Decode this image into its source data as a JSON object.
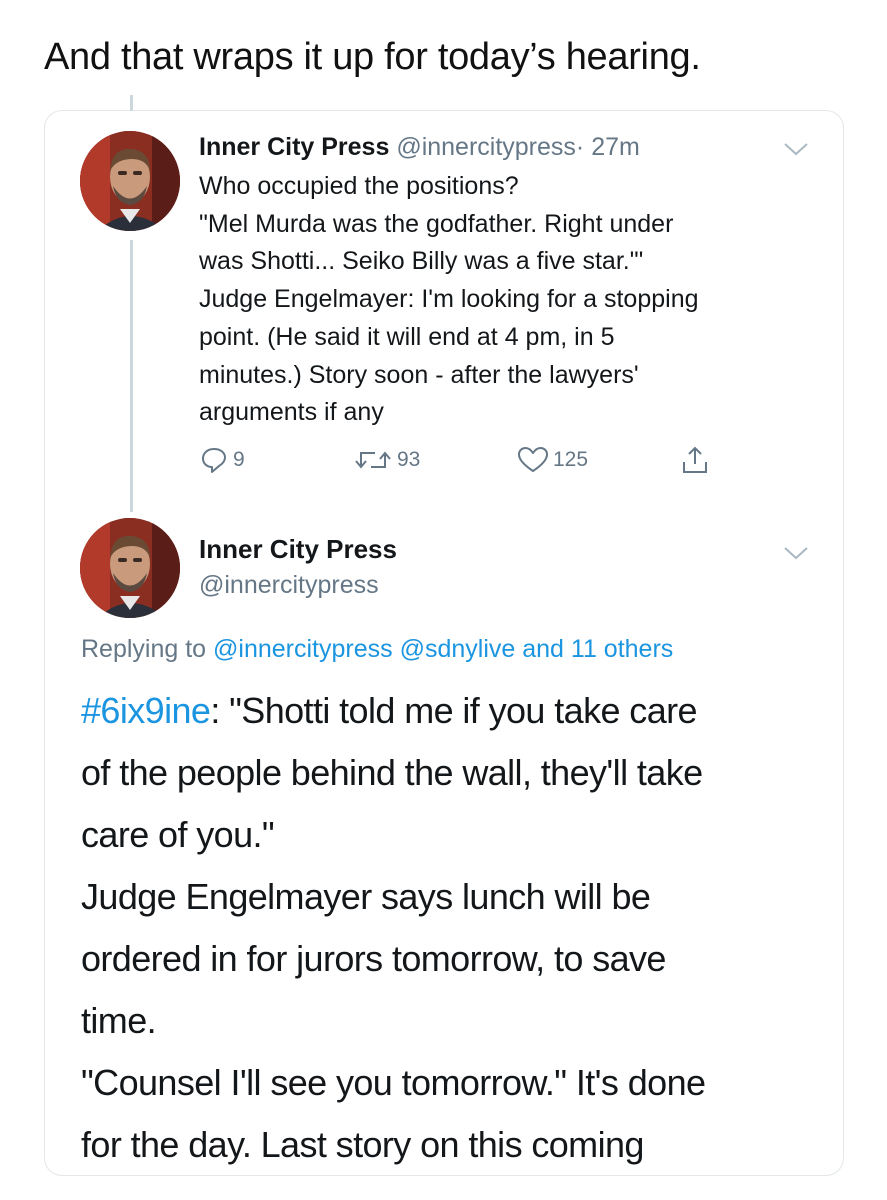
{
  "caption": "And that wraps it up for today’s hearing.",
  "tweet1": {
    "name": "Inner City Press",
    "handle": "@innercitypress",
    "separator": "·",
    "time": "27m",
    "lines": [
      "Who occupied the positions?",
      "\"Mel Murda was the godfather. Right under",
      "was Shotti... Seiko Billy was a five star.\"'",
      "Judge Engelmayer: I'm looking for a stopping",
      "point. (He said it will end at 4 pm, in 5",
      "minutes.) Story soon - after the lawyers'",
      "arguments if any"
    ],
    "replies": "9",
    "retweets": "93",
    "likes": "125"
  },
  "tweet2": {
    "name": "Inner City Press",
    "handle": "@innercitypress",
    "replying_prefix": "Replying to ",
    "replying_to_1": "@innercitypress",
    "replying_to_2": "@sdnylive",
    "replying_others": "and 11 others",
    "hashtag": "#6ix9ine",
    "first_line_rest": ": \"Shotti told me if you take care",
    "lines": [
      "of the people behind the wall, they'll take",
      "care of you.\"",
      "Judge Engelmayer says lunch will be",
      "ordered in for jurors tomorrow, to save",
      "time.",
      "\"Counsel I'll see you tomorrow.\" It's done",
      "for the day. Last story on this coming"
    ]
  },
  "colors": {
    "link": "#1b95e0",
    "secondary_text": "#657786",
    "primary_text": "#14171a",
    "thread_line": "#ccd6dd"
  },
  "icons": [
    "reply-icon",
    "retweet-icon",
    "like-icon",
    "share-icon",
    "chevron-down-icon"
  ]
}
